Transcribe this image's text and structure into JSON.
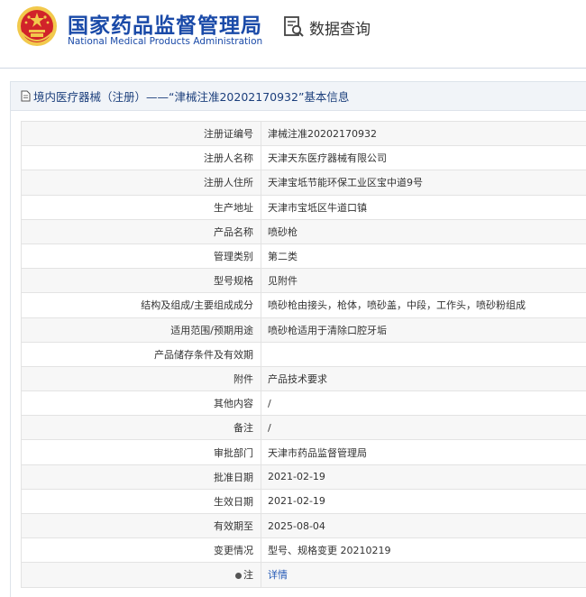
{
  "header": {
    "logo_cn": "国家药品监督管理局",
    "logo_en": "National Medical Products Administration",
    "query_label": "数据查询",
    "emblem_colors": {
      "red": "#d1232a",
      "gold": "#f2c94c"
    }
  },
  "panel": {
    "title": "境内医疗器械（注册）——“津械注准20202170932”基本信息"
  },
  "rows": [
    {
      "label": "注册证编号",
      "value": "津械注准20202170932"
    },
    {
      "label": "注册人名称",
      "value": "天津天东医疗器械有限公司"
    },
    {
      "label": "注册人住所",
      "value": "天津宝坻节能环保工业区宝中道9号"
    },
    {
      "label": "生产地址",
      "value": "天津市宝坻区牛道口镇"
    },
    {
      "label": "产品名称",
      "value": "喷砂枪"
    },
    {
      "label": "管理类别",
      "value": "第二类"
    },
    {
      "label": "型号规格",
      "value": "见附件"
    },
    {
      "label": "结构及组成/主要组成成分",
      "value": "喷砂枪由接头，枪体，喷砂盖，中段，工作头，喷砂粉组成"
    },
    {
      "label": "适用范围/预期用途",
      "value": "喷砂枪适用于清除口腔牙垢"
    },
    {
      "label": "产品储存条件及有效期",
      "value": ""
    },
    {
      "label": "附件",
      "value": "产品技术要求"
    },
    {
      "label": "其他内容",
      "value": "/"
    },
    {
      "label": "备注",
      "value": "/"
    },
    {
      "label": "审批部门",
      "value": "天津市药品监督管理局"
    },
    {
      "label": "批准日期",
      "value": "2021-02-19"
    },
    {
      "label": "生效日期",
      "value": "2021-02-19"
    },
    {
      "label": "有效期至",
      "value": "2025-08-04"
    },
    {
      "label": "变更情况",
      "value": "型号、规格变更 20210219"
    }
  ],
  "note": {
    "label": "注",
    "value": "详情"
  }
}
